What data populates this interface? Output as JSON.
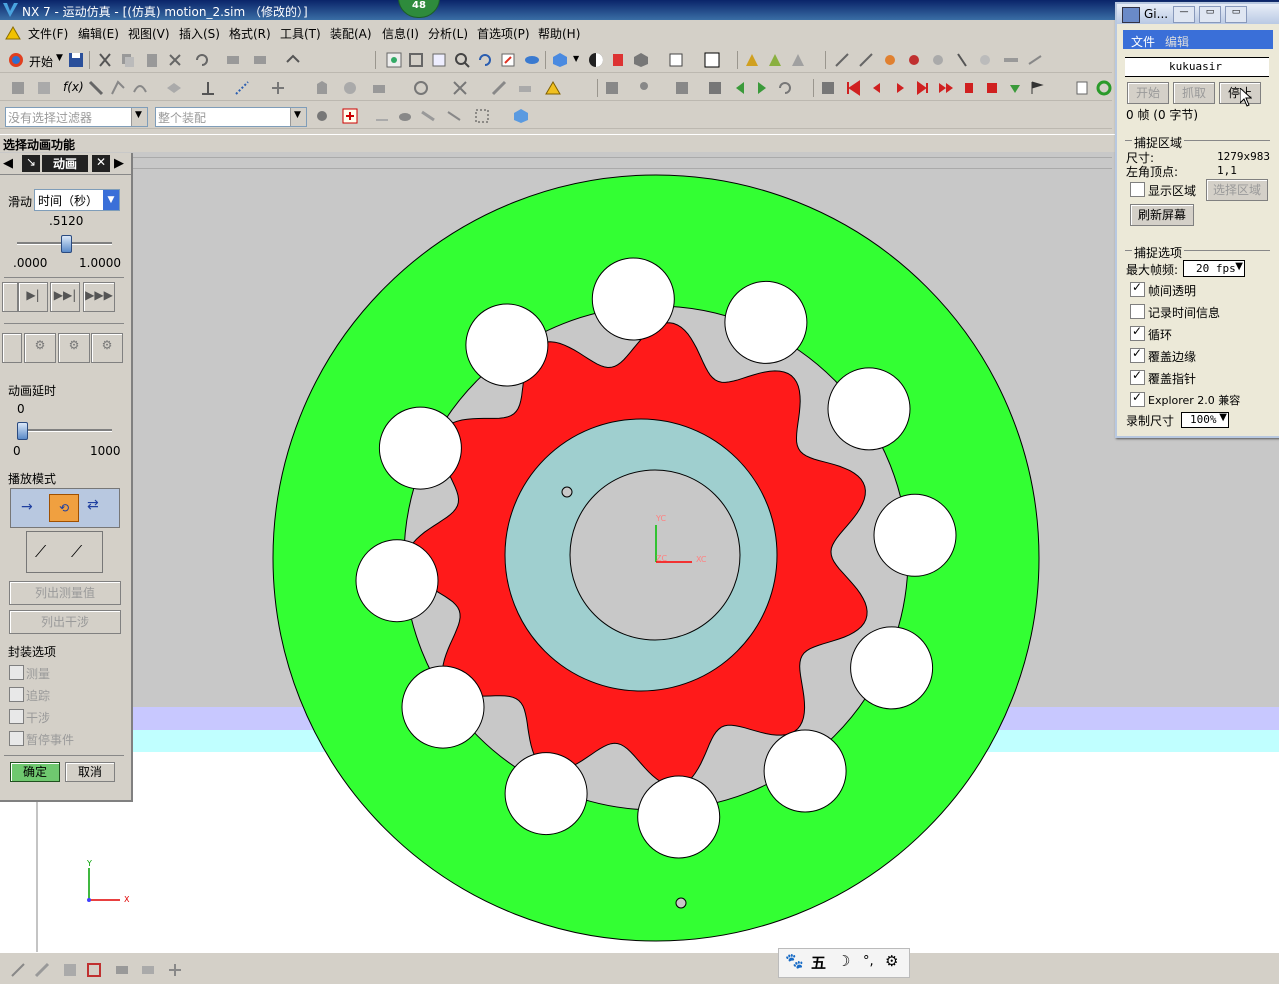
{
  "window": {
    "title": "NX 7 - 运动仿真 - [(仿真) motion_2.sim （修改的）]",
    "badge": "48"
  },
  "menu": [
    "文件(F)",
    "编辑(E)",
    "视图(V)",
    "插入(S)",
    "格式(R)",
    "工具(T)",
    "装配(A)",
    "信息(I)",
    "分析(L)",
    "首选项(P)",
    "帮助(H)"
  ],
  "toolbar": {
    "start_label": "开始",
    "filter_placeholder": "没有选择过滤器",
    "assembly_placeholder": "整个装配"
  },
  "status": {
    "prompt": "选择动画功能"
  },
  "panel": {
    "tab_label": "动画",
    "slider_label": "滑动",
    "slider_mode": "时间（秒）",
    "slider_value": ".5120",
    "slider_min": ".0000",
    "slider_max": "1.0000",
    "slider_fraction": 0.512,
    "delay_label": "动画延时",
    "delay_value": "0",
    "delay_min": "0",
    "delay_max": "1000",
    "playmode_label": "播放模式",
    "list_measure": "列出测量值",
    "list_interference": "列出干涉",
    "package_label": "封装选项",
    "options": [
      "测量",
      "追踪",
      "干涉",
      "暂停事件"
    ],
    "ok": "确定",
    "cancel": "取消"
  },
  "gif": {
    "title": "Gi...",
    "menu_file": "文件",
    "menu_edit": "编辑",
    "name": "kukuasir",
    "btn_start": "开始",
    "btn_capture": "抓取",
    "btn_stop": "停止",
    "frames": "0 帧 (0 字节)",
    "capture_area_label": "捕捉区域",
    "size_label": "尺寸:",
    "size_value": "1279x983",
    "corner_label": "左角顶点:",
    "corner_value": "1,1",
    "show_area": "显示区域",
    "select_area": "选择区域",
    "refresh": "刷新屏幕",
    "capture_opts_label": "捕捉选项",
    "max_fps_label": "最大帧频:",
    "max_fps_value": "20 fps",
    "opts": [
      {
        "label": "帧间透明",
        "on": true
      },
      {
        "label": "记录时间信息",
        "on": false
      },
      {
        "label": "循环",
        "on": true
      },
      {
        "label": "覆盖边缘",
        "on": true
      },
      {
        "label": "覆盖指针",
        "on": true
      },
      {
        "label": "Explorer 2.0 兼容",
        "on": true
      }
    ],
    "record_size_label": "录制尺寸",
    "record_size_value": "100%"
  },
  "axes": {
    "xc": "XC",
    "yc": "YC",
    "zc": "ZC",
    "x": "X",
    "y": "Y"
  },
  "ime": {
    "char": "五"
  },
  "colors": {
    "outer_ring": "#33ff33",
    "gear": "#ff1a1a",
    "inner_ring": "#9fcfcf",
    "background": "#c8c8c8"
  }
}
